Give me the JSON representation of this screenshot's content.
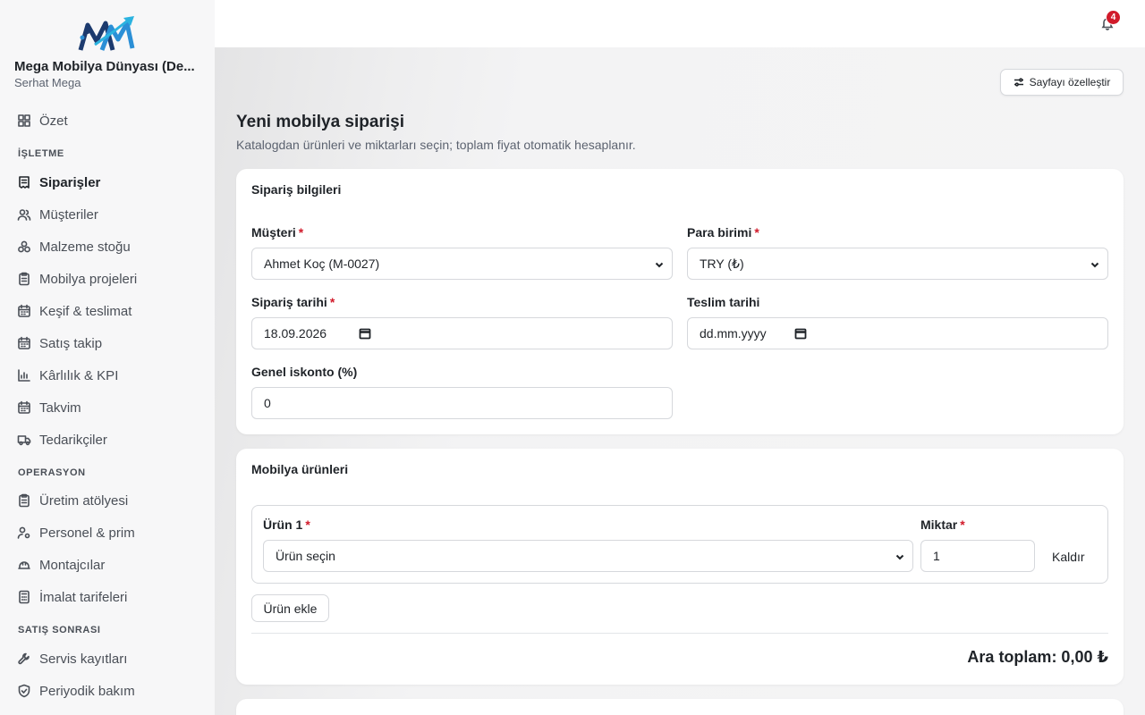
{
  "brand": {
    "name": "Mega Mobilya Dünyası (De...",
    "user": "Serhat Mega"
  },
  "sidebar": {
    "items": [
      {
        "label": "Özet",
        "icon": "grid-icon"
      },
      {
        "section": "İŞLETME"
      },
      {
        "label": "Siparişler",
        "icon": "receipt-icon",
        "active": true
      },
      {
        "label": "Müşteriler",
        "icon": "users-icon"
      },
      {
        "label": "Malzeme stoğu",
        "icon": "boxes-icon"
      },
      {
        "label": "Mobilya projeleri",
        "icon": "clipboard-icon"
      },
      {
        "label": "Keşif & teslimat",
        "icon": "calendar-icon"
      },
      {
        "label": "Satış takip",
        "icon": "calendar-icon"
      },
      {
        "label": "Kârlılık & KPI",
        "icon": "bar-chart-icon"
      },
      {
        "label": "Takvim",
        "icon": "calendar-icon"
      },
      {
        "label": "Tedarikçiler",
        "icon": "truck-icon"
      },
      {
        "section": "OPERASYON"
      },
      {
        "label": "Üretim atölyesi",
        "icon": "clipboard-icon"
      },
      {
        "label": "Personel & prim",
        "icon": "user-settings-icon"
      },
      {
        "label": "Montajcılar",
        "icon": "hard-hat-icon"
      },
      {
        "label": "İmalat tarifeleri",
        "icon": "calculator-icon"
      },
      {
        "section": "SATIŞ SONRASI"
      },
      {
        "label": "Servis kayıtları",
        "icon": "wrench-icon"
      },
      {
        "label": "Periyodik bakım",
        "icon": "shield-check-icon"
      }
    ]
  },
  "notifications": {
    "count": "4"
  },
  "header": {
    "customize_label": "Sayfayı özelleştir",
    "title": "Yeni mobilya siparişi",
    "subtitle": "Katalogdan ürünleri ve miktarları seçin; toplam fiyat otomatik hesaplanır."
  },
  "order_info": {
    "title": "Sipariş bilgileri",
    "customer_label": "Müşteri",
    "customer_value": "Ahmet Koç (M-0027)",
    "currency_label": "Para birimi",
    "currency_value": "TRY (₺)",
    "order_date_label": "Sipariş tarihi",
    "order_date_value": "18.09.2026",
    "delivery_date_label": "Teslim tarihi",
    "delivery_date_value": "dd.mm.yyyy",
    "discount_label": "Genel iskonto (%)",
    "discount_value": "0",
    "required_mark": "*"
  },
  "products": {
    "title": "Mobilya ürünleri",
    "product_label": "Ürün 1",
    "product_value": "Ürün seçin",
    "quantity_label": "Miktar",
    "quantity_value": "1",
    "remove_label": "Kaldır",
    "add_label": "Ürün ekle",
    "subtotal": "Ara toplam: 0,00 ₺"
  },
  "colors": {
    "accent_required": "#d11a2a",
    "badge": "#d11a2a",
    "sidebar_bg": "#f7f7f8",
    "main_bg": "#f3f3f4"
  }
}
